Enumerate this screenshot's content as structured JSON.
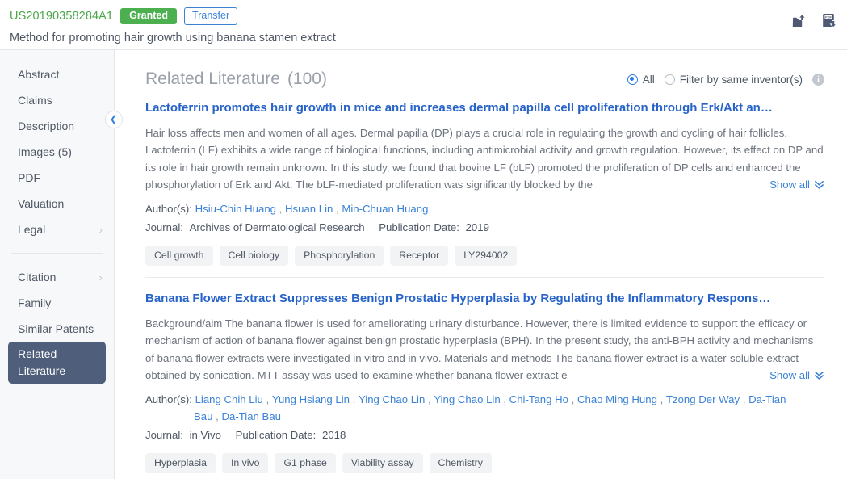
{
  "header": {
    "patent_number": "US20190358284A1",
    "badge_granted": "Granted",
    "badge_transfer": "Transfer",
    "title": "Method for promoting hair growth using banana stamen extract",
    "icons": [
      {
        "name": "share-upload-icon"
      },
      {
        "name": "pdf-download-icon"
      }
    ]
  },
  "sidebar": {
    "items": [
      {
        "label": "Abstract",
        "chevron": "",
        "active": false
      },
      {
        "label": "Claims",
        "chevron": "",
        "active": false
      },
      {
        "label": "Description",
        "chevron": "",
        "active": false
      },
      {
        "label": "Images (5)",
        "chevron": "",
        "active": false
      },
      {
        "label": "PDF",
        "chevron": "",
        "active": false
      },
      {
        "label": "Valuation",
        "chevron": "",
        "active": false
      },
      {
        "label": "Legal",
        "chevron": "›",
        "active": false
      }
    ],
    "items2": [
      {
        "label": "Citation",
        "chevron": "›",
        "active": false
      },
      {
        "label": "Family",
        "chevron": "",
        "active": false
      },
      {
        "label": "Similar Patents",
        "chevron": "",
        "active": false
      },
      {
        "label": "Related Literature",
        "chevron": "",
        "active": true
      }
    ],
    "collapse_icon": "❮"
  },
  "main": {
    "page_title": "Related Literature",
    "page_count": "(100)",
    "filter": {
      "option_all": "All",
      "option_inventor": "Filter by same inventor(s)",
      "selected": "All",
      "info_icon": "i"
    },
    "show_all_label": "Show all",
    "show_all_chevron": "⌄⌄",
    "labels": {
      "authors": "Author(s):",
      "journal": "Journal:",
      "publication_date": "Publication Date:"
    },
    "articles": [
      {
        "title": "Lactoferrin promotes hair growth in mice and increases dermal papilla cell proliferation through Erk/Akt an…",
        "abstract": "Hair loss affects men and women of all ages. Dermal papilla (DP) plays a crucial role in regulating the growth and cycling of hair follicles. Lactoferrin (LF) exhibits a wide range of biological functions, including antimicrobial activity and growth regulation. However, its effect on DP and its role in hair growth remain unknown. In this study, we found that bovine LF (bLF) promoted the proliferation of DP cells and enhanced the phosphorylation of Erk and Akt. The bLF-mediated proliferation was significantly blocked by the",
        "authors": [
          "Hsiu-Chin Huang",
          "Hsuan Lin",
          "Min-Chuan Huang"
        ],
        "journal": "Archives of Dermatological Research",
        "publication_date": "2019",
        "tags": [
          "Cell growth",
          "Cell biology",
          "Phosphorylation",
          "Receptor",
          "LY294002"
        ]
      },
      {
        "title": "Banana Flower Extract Suppresses Benign Prostatic Hyperplasia by Regulating the Inflammatory Respons…",
        "abstract": "Background/aim The banana flower is used for ameliorating urinary disturbance. However, there is limited evidence to support the efficacy or mechanism of action of banana flower against benign prostatic hyperplasia (BPH). In the present study, the anti-BPH activity and mechanisms of banana flower extracts were investigated in vitro and in vivo. Materials and methods The banana flower extract is a water-soluble extract obtained by sonication. MTT assay was used to examine whether banana flower extract e",
        "authors": [
          "Liang Chih Liu",
          "Yung Hsiang Lin",
          "Ying Chao Lin",
          "Ying Chao Lin",
          "Chi-Tang Ho",
          "Chao Ming Hung",
          "Tzong Der Way",
          "Da-Tian Bau",
          "Da-Tian Bau"
        ],
        "journal": "in Vivo",
        "publication_date": "2018",
        "tags": [
          "Hyperplasia",
          "In vivo",
          "G1 phase",
          "Viability assay",
          "Chemistry"
        ]
      }
    ]
  },
  "colors": {
    "accent_blue": "#3b82d6",
    "link_blue": "#2763c9",
    "granted_green": "#4caf50",
    "sidebar_active": "#4f5e7b",
    "muted_text": "#9aa0aa"
  }
}
